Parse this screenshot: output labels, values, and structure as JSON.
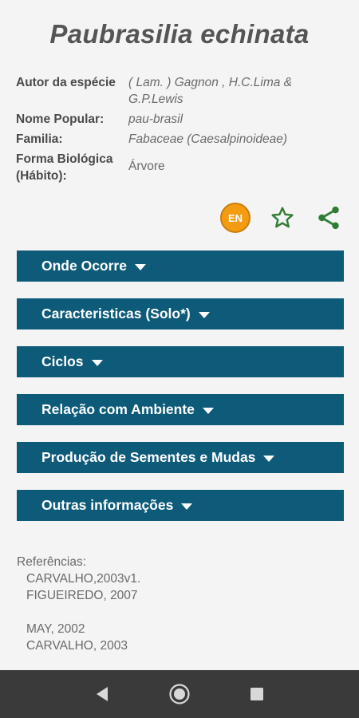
{
  "species": {
    "title": "Paubrasilia echinata",
    "fields": [
      {
        "label": "Autor da espécie",
        "value": "( Lam. ) Gagnon , H.C.Lima & G.P.Lewis"
      },
      {
        "label": "Nome Popular:",
        "value": "pau-brasil"
      },
      {
        "label": "Familia:",
        "value": "Fabaceae (Caesalpinoideae)"
      },
      {
        "label": "Forma Biológica (Hábito):",
        "value": "Árvore"
      }
    ]
  },
  "actions": {
    "language_badge": "EN",
    "favorite_icon": "star-outline-icon",
    "share_icon": "share-icon",
    "accent_color": "#2e7d32",
    "badge_color": "#f39c12"
  },
  "sections": [
    {
      "label": "Onde Ocorre"
    },
    {
      "label": "Caracteristicas (Solo*)"
    },
    {
      "label": "Ciclos"
    },
    {
      "label": "Relação com Ambiente"
    },
    {
      "label": "Produção de Sementes e Mudas"
    },
    {
      "label": "Outras informações"
    }
  ],
  "section_color": "#0d5a79",
  "references": {
    "title": "Referências:",
    "items": [
      "CARVALHO,2003v1.",
      "FIGUEIREDO, 2007",
      "MAY, 2002",
      "CARVALHO, 2003"
    ]
  },
  "navbar": {
    "back_icon": "back-triangle-icon",
    "home_icon": "home-circle-icon",
    "recents_icon": "recents-square-icon"
  }
}
